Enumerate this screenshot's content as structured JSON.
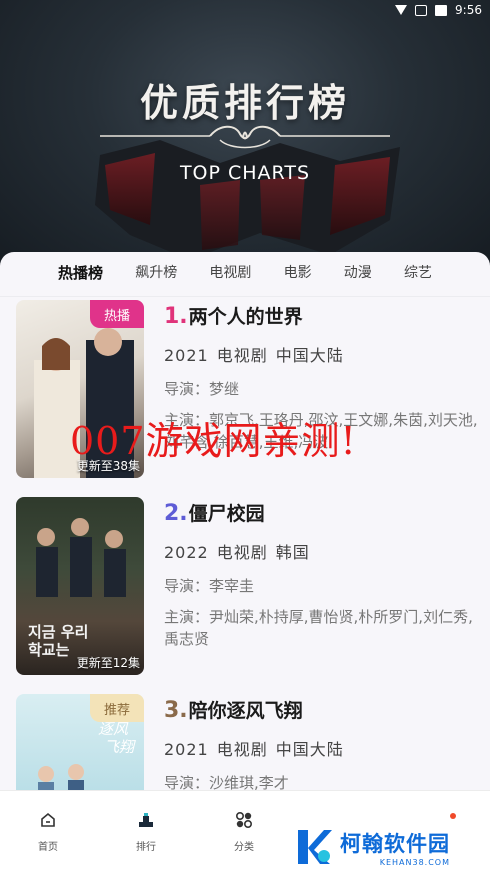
{
  "status": {
    "time": "9:56"
  },
  "hero": {
    "title": "优质排行榜",
    "subtitle": "TOP CHARTS"
  },
  "tabs": [
    {
      "label": "热播榜",
      "active": true
    },
    {
      "label": "飙升榜"
    },
    {
      "label": "电视剧"
    },
    {
      "label": "电影"
    },
    {
      "label": "动漫"
    },
    {
      "label": "综艺"
    }
  ],
  "items": [
    {
      "rank": "1.",
      "rank_color": "#e0337a",
      "title": "两个人的世界",
      "year": "2021",
      "category": "电视剧",
      "region": "中国大陆",
      "director": "导演：梦继",
      "cast": "主演：郭京飞,王珞丹,邵汶,王文娜,朱茵,刘天池,刘芊含,徐百慧,王维,冯波",
      "badge": "热播",
      "badge_color": "#e0338a",
      "update": "更新至38集",
      "poster_title": "两个人的世界"
    },
    {
      "rank": "2.",
      "rank_color": "#5e5cd6",
      "title": "僵尸校园",
      "year": "2022",
      "category": "电视剧",
      "region": "韩国",
      "director": "导演：李宰圭",
      "cast": "主演：尹灿荣,朴持厚,曹怡贤,朴所罗门,刘仁秀,禹志贤",
      "update": "更新至12集",
      "poster_title": "지금 우리 학교는"
    },
    {
      "rank": "3.",
      "rank_color": "#8a6a4a",
      "title": "陪你逐风飞翔",
      "year": "2021",
      "category": "电视剧",
      "region": "中国大陆",
      "director": "导演：沙维琪,李才",
      "badge": "推荐",
      "badge_color": "#f3e3b8",
      "badge_text_color": "#8a6a3a",
      "poster_title": "逐风飞翔"
    }
  ],
  "watermark": "007游戏网亲测!",
  "nav": [
    {
      "label": "首页",
      "icon": "home-icon"
    },
    {
      "label": "排行",
      "icon": "ranking-icon"
    },
    {
      "label": "分类",
      "icon": "category-icon"
    }
  ],
  "logo": {
    "cn": "柯翰软件园",
    "en": "KEHAN38.COM"
  }
}
